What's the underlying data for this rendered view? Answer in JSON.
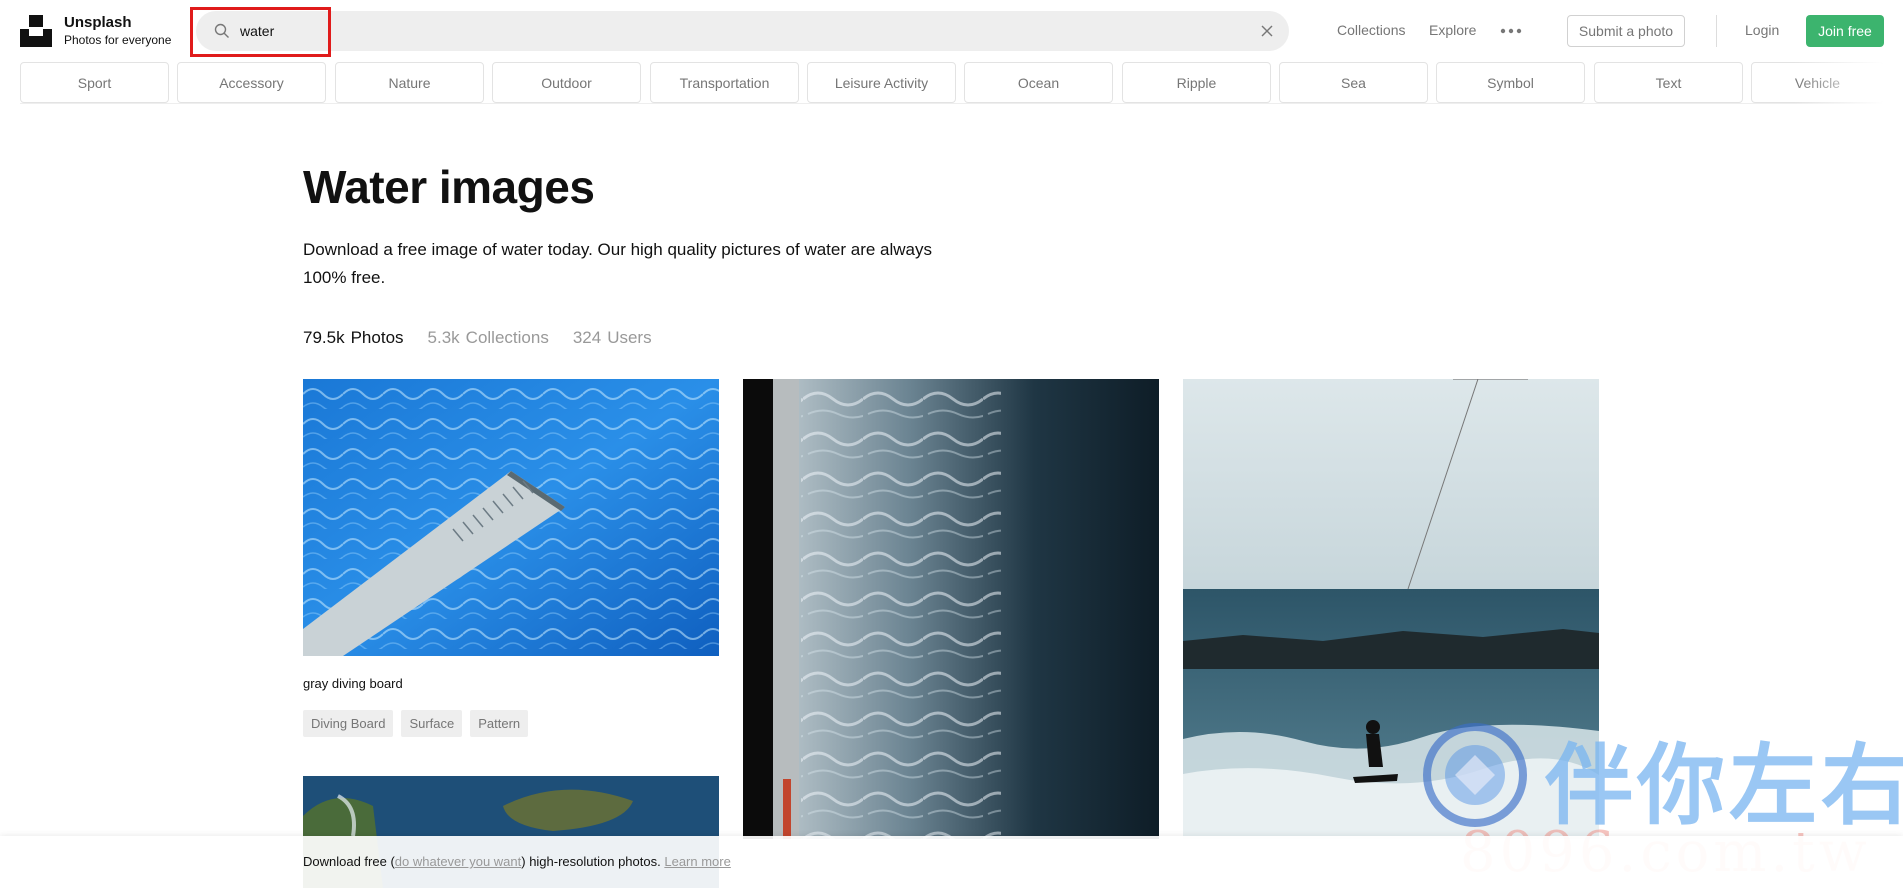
{
  "header": {
    "brand_name": "Unsplash",
    "brand_tagline": "Photos for everyone",
    "search_value": "water",
    "nav": [
      "Collections",
      "Explore"
    ],
    "submit_label": "Submit a photo",
    "login_label": "Login",
    "join_label": "Join free",
    "join_color": "#3cb46e"
  },
  "categories": [
    "Sport",
    "Accessory",
    "Nature",
    "Outdoor",
    "Transportation",
    "Leisure Activity",
    "Ocean",
    "Ripple",
    "Sea",
    "Symbol",
    "Text",
    "Vehicle"
  ],
  "main": {
    "title": "Water images",
    "description": "Download a free image of water today. Our high quality pictures of water are always 100% free.",
    "tabs": [
      {
        "count": "79.5k",
        "label": "Photos"
      },
      {
        "count": "5.3k",
        "label": "Collections"
      },
      {
        "count": "324",
        "label": "Users"
      }
    ]
  },
  "photos": [
    {
      "caption": "gray diving board",
      "tags": [
        "Diving Board",
        "Surface",
        "Pattern"
      ]
    }
  ],
  "footer": {
    "prefix": "Download free (",
    "link": "do whatever you want",
    "middle": ") high-resolution photos.",
    "learn_more": "Learn more"
  },
  "watermark": {
    "chinese": "伴你左右",
    "domain": "8096.com.tw"
  }
}
